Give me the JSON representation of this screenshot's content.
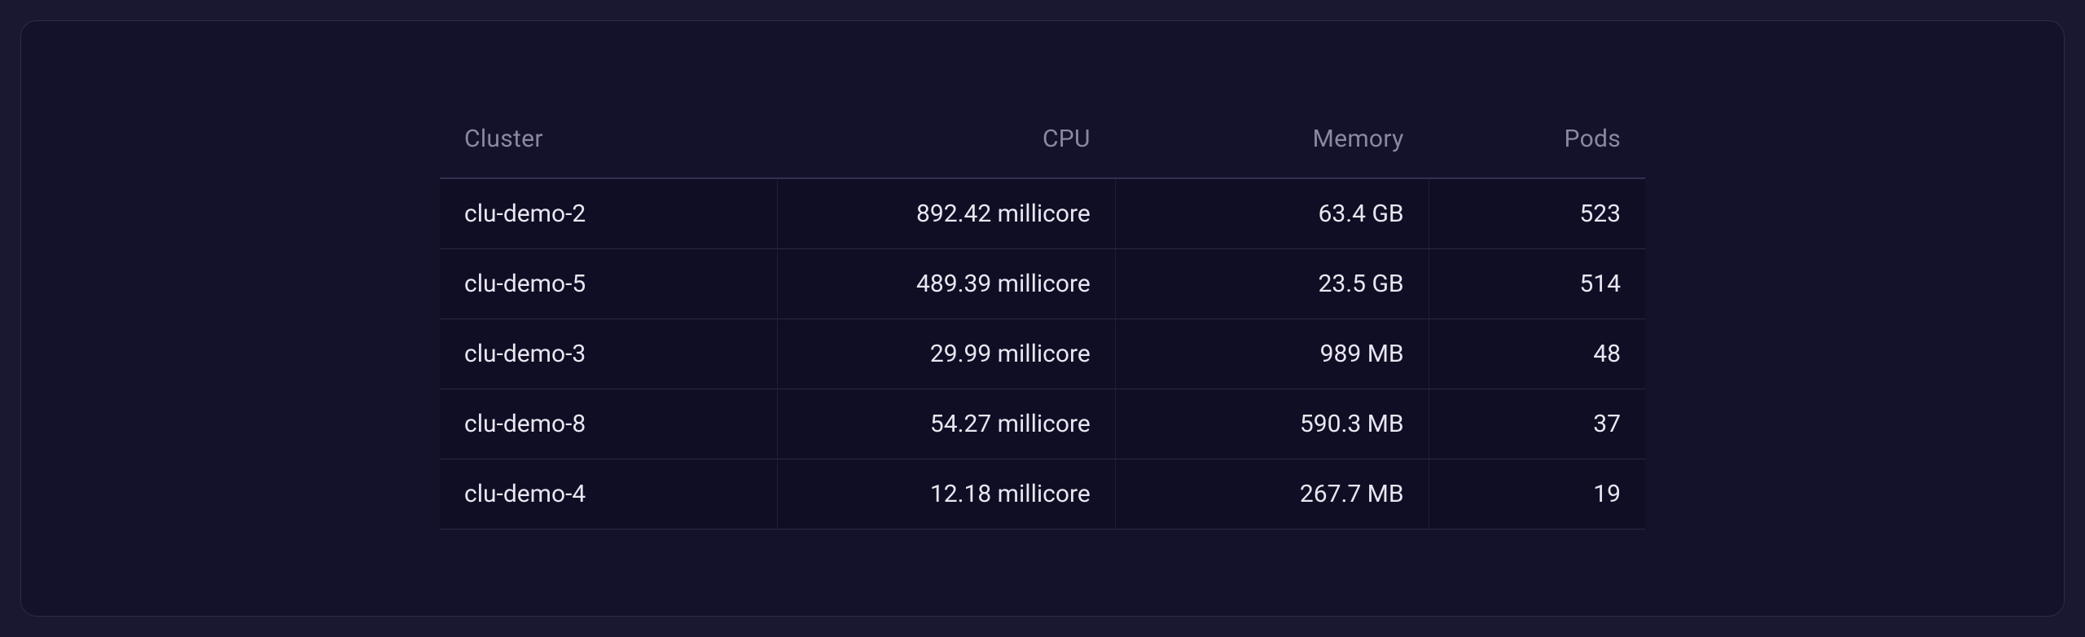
{
  "table": {
    "columns": [
      "Cluster",
      "CPU",
      "Memory",
      "Pods"
    ],
    "rows": [
      {
        "cluster": "clu-demo-2",
        "cpu": "892.42 millicore",
        "memory": "63.4 GB",
        "pods": "523"
      },
      {
        "cluster": "clu-demo-5",
        "cpu": "489.39 millicore",
        "memory": "23.5 GB",
        "pods": "514"
      },
      {
        "cluster": "clu-demo-3",
        "cpu": "29.99 millicore",
        "memory": "989 MB",
        "pods": "48"
      },
      {
        "cluster": "clu-demo-8",
        "cpu": "54.27 millicore",
        "memory": "590.3 MB",
        "pods": "37"
      },
      {
        "cluster": "clu-demo-4",
        "cpu": "12.18 millicore",
        "memory": "267.7 MB",
        "pods": "19"
      }
    ]
  }
}
